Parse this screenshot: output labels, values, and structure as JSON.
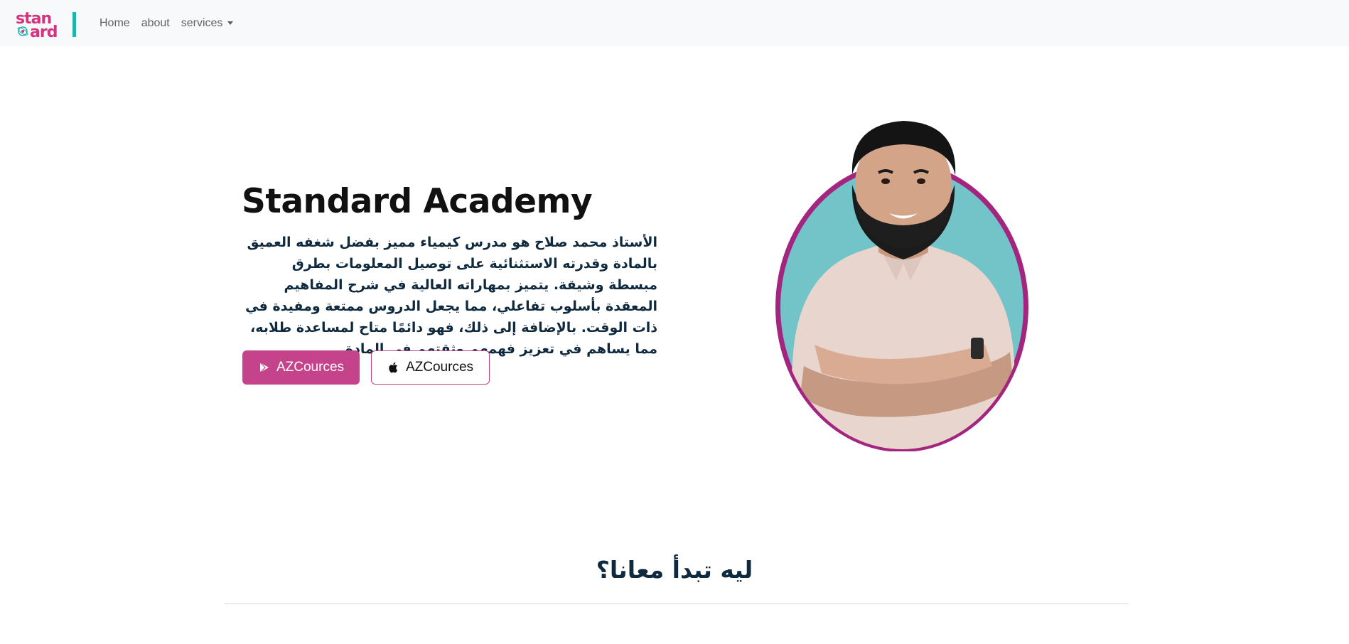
{
  "nav": {
    "logo_text": "standard",
    "items": [
      {
        "label": "Home"
      },
      {
        "label": "about"
      },
      {
        "label": "services"
      }
    ]
  },
  "hero": {
    "title": "Standard Academy",
    "description": "الأستاذ محمد صلاح هو مدرس كيمياء مميز بفضل شغفه العميق بالمادة وقدرته الاستثنائية على توصيل المعلومات بطرق مبسطة وشيقة. يتميز بمهاراته العالية في شرح المفاهيم المعقدة بأسلوب تفاعلي، مما يجعل الدروس ممتعة ومفيدة في ذات الوقت. بالإضافة إلى ذلك، فهو دائمًا متاح لمساعدة طلابه، مما يساهم في تعزيز فهمهم وثقتهم في المادة.",
    "buttons": [
      {
        "label": "AZCources",
        "icon": "google-play-icon"
      },
      {
        "label": "AZCources",
        "icon": "apple-icon"
      }
    ]
  },
  "section": {
    "title": "ليه تبدأ معانا؟"
  },
  "colors": {
    "accent": "#c5438a",
    "circle_ring": "#a3257f",
    "circle_fill": "#73c4c9",
    "navbar_bg": "#f8f9fa",
    "logo_pink": "#d6337f",
    "logo_teal": "#1fb5ad"
  }
}
